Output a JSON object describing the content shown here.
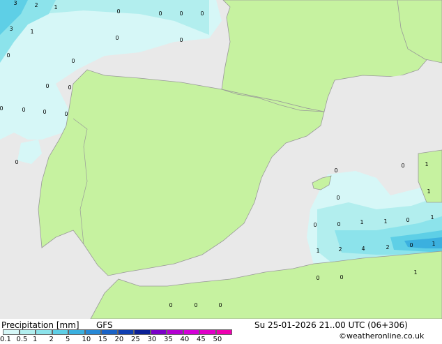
{
  "legend": {
    "title": "Precipitation [mm]",
    "model": "GFS",
    "datetime": "Su 25-01-2026 21..00 UTC (06+306)",
    "credit": "©weatheronline.co.uk",
    "ticks": [
      "0.1",
      "0.5",
      "1",
      "2",
      "5",
      "10",
      "15",
      "20",
      "25",
      "30",
      "35",
      "40",
      "45",
      "50"
    ],
    "colors": [
      "#d6f7f7",
      "#b2eeee",
      "#8ce3eb",
      "#5ecfe6",
      "#3bb0df",
      "#2688d6",
      "#1a63c6",
      "#0f3fb2",
      "#0a1f96",
      "#7a00c8",
      "#b400d2",
      "#d400d8",
      "#e000c8",
      "#ee00b0"
    ]
  },
  "map_colors": {
    "sea": "#e9e9e9",
    "land": "#c6f2a0",
    "border": "#999999"
  },
  "cell_values": [
    "3",
    "2",
    "1",
    "3",
    "1",
    "0",
    "0",
    "0",
    "0",
    "0",
    "0",
    "0",
    "0",
    "0",
    "0",
    "0",
    "0",
    "0",
    "0",
    "0",
    "0",
    "0",
    "1",
    "0",
    "1",
    "0",
    "0",
    "1",
    "1",
    "0",
    "1",
    "1",
    "2",
    "4",
    "2",
    "0",
    "1",
    "1",
    "0",
    "0",
    "0",
    "0",
    "0"
  ]
}
